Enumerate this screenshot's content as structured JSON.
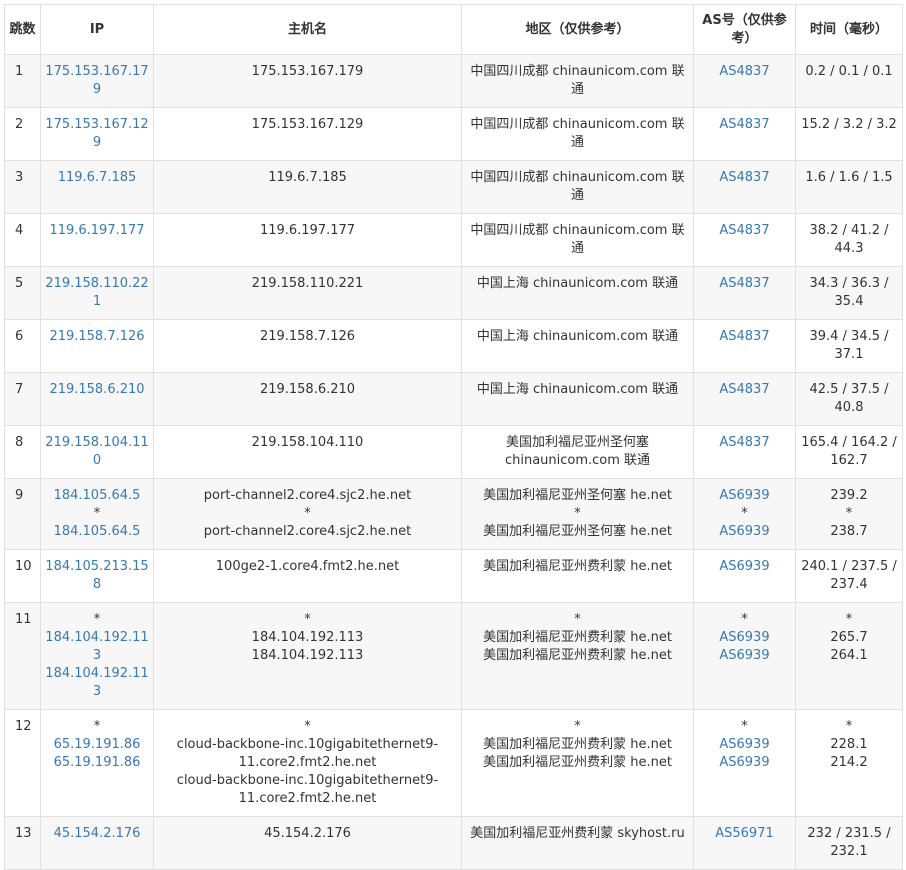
{
  "headers": {
    "hop": "跳数",
    "ip": "IP",
    "host": "主机名",
    "region": "地区（仅供参考）",
    "as": "AS号（仅供参考）",
    "time": "时间（毫秒）"
  },
  "rows": [
    {
      "hop": "1",
      "ip": [
        "175.153.167.179"
      ],
      "host": [
        "175.153.167.179"
      ],
      "region": [
        "中国四川成都 chinaunicom.com 联通"
      ],
      "as": [
        "AS4837"
      ],
      "time": [
        "0.2 / 0.1 / 0.1"
      ]
    },
    {
      "hop": "2",
      "ip": [
        "175.153.167.129"
      ],
      "host": [
        "175.153.167.129"
      ],
      "region": [
        "中国四川成都 chinaunicom.com 联通"
      ],
      "as": [
        "AS4837"
      ],
      "time": [
        "15.2 / 3.2 / 3.2"
      ]
    },
    {
      "hop": "3",
      "ip": [
        "119.6.7.185"
      ],
      "host": [
        "119.6.7.185"
      ],
      "region": [
        "中国四川成都 chinaunicom.com 联通"
      ],
      "as": [
        "AS4837"
      ],
      "time": [
        "1.6 / 1.6 / 1.5"
      ]
    },
    {
      "hop": "4",
      "ip": [
        "119.6.197.177"
      ],
      "host": [
        "119.6.197.177"
      ],
      "region": [
        "中国四川成都 chinaunicom.com 联通"
      ],
      "as": [
        "AS4837"
      ],
      "time": [
        "38.2 / 41.2 /",
        "44.3"
      ]
    },
    {
      "hop": "5",
      "ip": [
        "219.158.110.221"
      ],
      "host": [
        "219.158.110.221"
      ],
      "region": [
        "中国上海 chinaunicom.com 联通"
      ],
      "as": [
        "AS4837"
      ],
      "time": [
        "34.3 / 36.3 /",
        "35.4"
      ]
    },
    {
      "hop": "6",
      "ip": [
        "219.158.7.126"
      ],
      "host": [
        "219.158.7.126"
      ],
      "region": [
        "中国上海 chinaunicom.com 联通"
      ],
      "as": [
        "AS4837"
      ],
      "time": [
        "39.4 / 34.5 /",
        "37.1"
      ]
    },
    {
      "hop": "7",
      "ip": [
        "219.158.6.210"
      ],
      "host": [
        "219.158.6.210"
      ],
      "region": [
        "中国上海 chinaunicom.com 联通"
      ],
      "as": [
        "AS4837"
      ],
      "time": [
        "42.5 / 37.5 /",
        "40.8"
      ]
    },
    {
      "hop": "8",
      "ip": [
        "219.158.104.110"
      ],
      "host": [
        "219.158.104.110"
      ],
      "region": [
        "美国加利福尼亚州圣何塞",
        "chinaunicom.com 联通"
      ],
      "as": [
        "AS4837"
      ],
      "time": [
        "165.4 / 164.2 /",
        "162.7"
      ]
    },
    {
      "hop": "9",
      "ip": [
        "184.105.64.5",
        "*",
        "184.105.64.5"
      ],
      "host": [
        "port-channel2.core4.sjc2.he.net",
        "*",
        "port-channel2.core4.sjc2.he.net"
      ],
      "region": [
        "美国加利福尼亚州圣何塞 he.net",
        "*",
        "美国加利福尼亚州圣何塞 he.net"
      ],
      "as": [
        "AS6939",
        "*",
        "AS6939"
      ],
      "time": [
        "239.2",
        "*",
        "238.7"
      ]
    },
    {
      "hop": "10",
      "ip": [
        "184.105.213.158"
      ],
      "host": [
        "100ge2-1.core4.fmt2.he.net"
      ],
      "region": [
        "美国加利福尼亚州费利蒙 he.net"
      ],
      "as": [
        "AS6939"
      ],
      "time": [
        "240.1 / 237.5 /",
        "237.4"
      ]
    },
    {
      "hop": "11",
      "ip": [
        "*",
        "184.104.192.113",
        "184.104.192.113"
      ],
      "host": [
        "*",
        "184.104.192.113",
        "184.104.192.113"
      ],
      "region": [
        "*",
        "美国加利福尼亚州费利蒙 he.net",
        "美国加利福尼亚州费利蒙 he.net"
      ],
      "as": [
        "*",
        "AS6939",
        "AS6939"
      ],
      "time": [
        "*",
        "265.7",
        "264.1"
      ]
    },
    {
      "hop": "12",
      "ip": [
        "*",
        "65.19.191.86",
        "65.19.191.86"
      ],
      "host": [
        "*",
        "cloud-backbone-inc.10gigabitethernet9-",
        "11.core2.fmt2.he.net",
        "cloud-backbone-inc.10gigabitethernet9-",
        "11.core2.fmt2.he.net"
      ],
      "region": [
        "*",
        "美国加利福尼亚州费利蒙 he.net",
        "美国加利福尼亚州费利蒙 he.net"
      ],
      "as": [
        "*",
        "AS6939",
        "AS6939"
      ],
      "time": [
        "*",
        "228.1",
        "214.2"
      ]
    },
    {
      "hop": "13",
      "ip": [
        "45.154.2.176"
      ],
      "host": [
        "45.154.2.176"
      ],
      "region": [
        "美国加利福尼亚州费利蒙 skyhost.ru"
      ],
      "as": [
        "AS56971"
      ],
      "time": [
        "232 / 231.5 /",
        "232.1"
      ]
    }
  ]
}
